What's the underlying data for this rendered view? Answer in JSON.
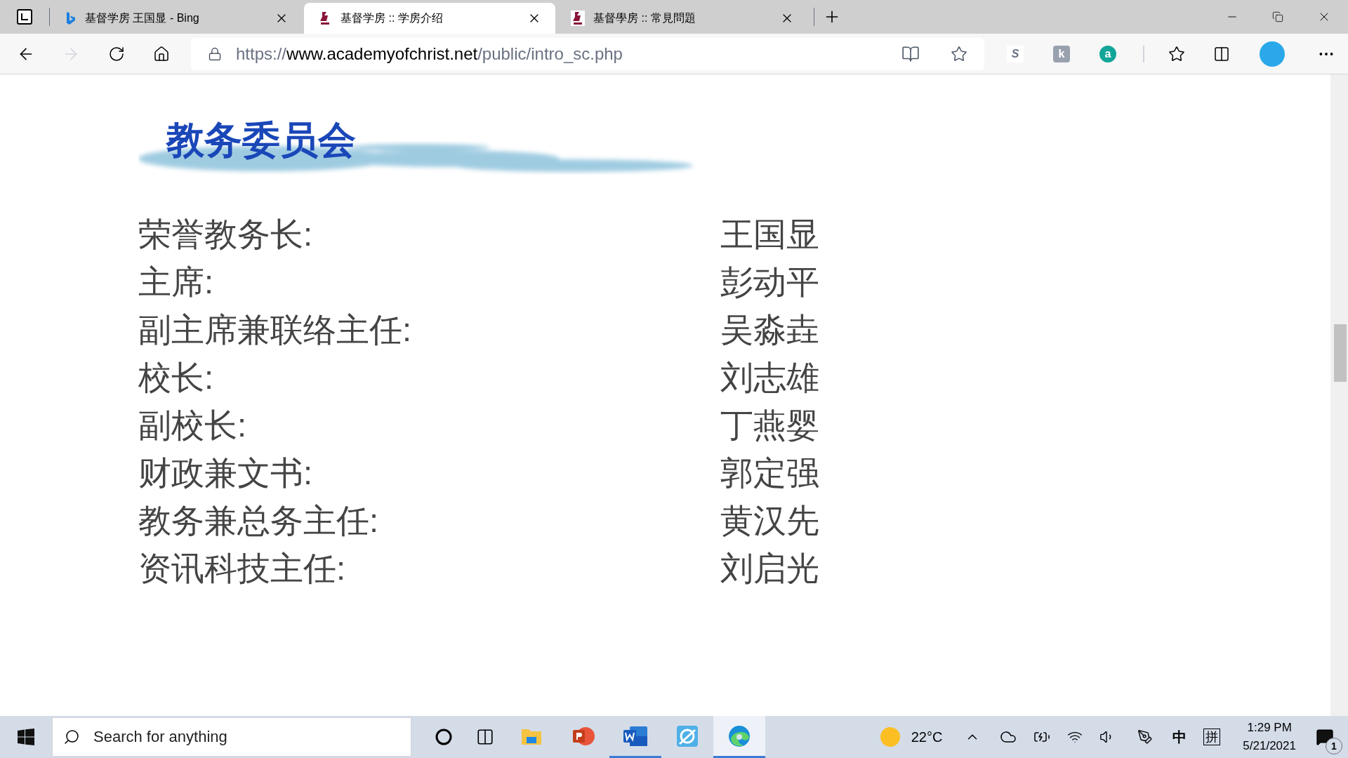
{
  "tabs": [
    {
      "title": "基督学房 王国显 - Bing",
      "kind": "bing",
      "selected": false
    },
    {
      "title": "基督学房 :: 学房介绍",
      "kind": "site",
      "selected": true
    },
    {
      "title": "基督學房 :: 常見問題",
      "kind": "site",
      "selected": false
    }
  ],
  "address": {
    "scheme": "https://",
    "host": "www.academyofchrist.net",
    "path": "/public/intro_sc.php"
  },
  "extensions": [
    {
      "label": "S",
      "kind": "s"
    },
    {
      "label": "k",
      "kind": "k"
    },
    {
      "label": "a",
      "kind": "a"
    }
  ],
  "page": {
    "heading": "教务委员会",
    "members": [
      {
        "role": "荣誉教务长:",
        "name": "王国显"
      },
      {
        "role": "主席:",
        "name": "彭动平"
      },
      {
        "role": "副主席兼联络主任:",
        "name": "吴淼垚"
      },
      {
        "role": "校长:",
        "name": "刘志雄"
      },
      {
        "role": "副校长:",
        "name": "丁燕婴"
      },
      {
        "role": "财政兼文书:",
        "name": "郭定强"
      },
      {
        "role": "教务兼总务主任:",
        "name": "黄汉先"
      },
      {
        "role": "资讯科技主任:",
        "name": "刘启光"
      }
    ]
  },
  "taskbar": {
    "search_placeholder": "Search for anything",
    "apps": [
      {
        "kind": "explorer",
        "running": false,
        "selected": false
      },
      {
        "kind": "powerpoint",
        "running": false,
        "selected": false
      },
      {
        "kind": "word",
        "running": true,
        "selected": false
      },
      {
        "kind": "app",
        "running": false,
        "selected": false
      },
      {
        "kind": "edge",
        "running": true,
        "selected": true
      }
    ],
    "weather": "22°C",
    "ime_mode": "中",
    "ime": "拼",
    "time": "1:29 PM",
    "date": "5/21/2021",
    "notifications": "1"
  }
}
